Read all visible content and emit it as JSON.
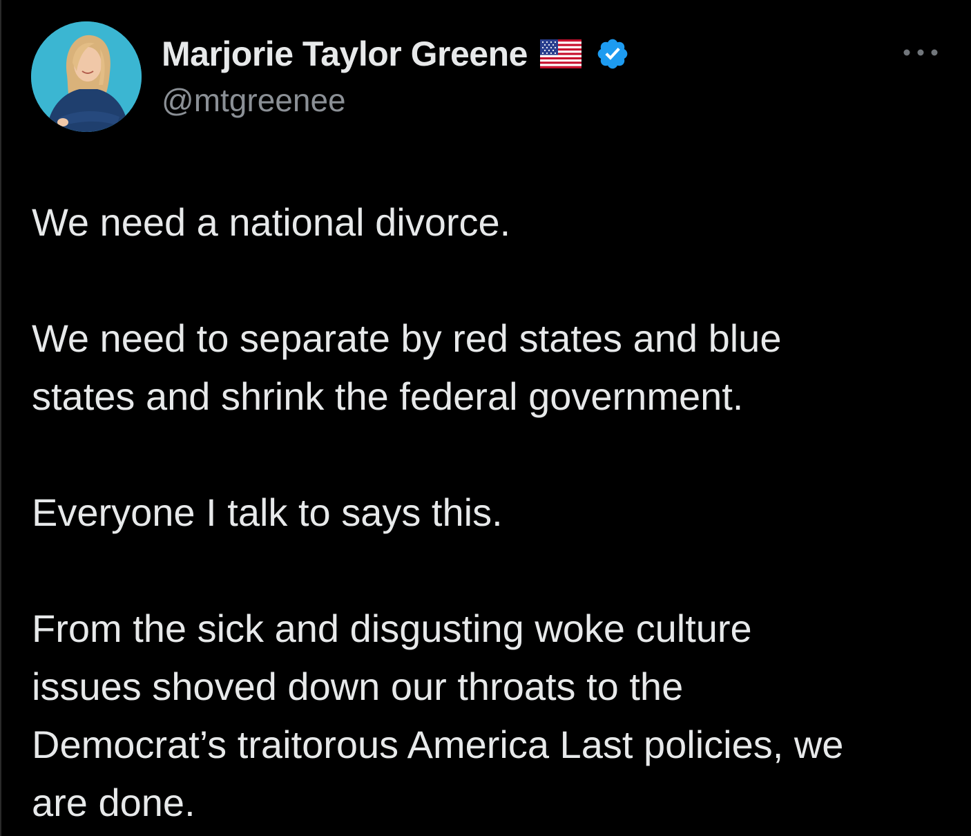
{
  "author": {
    "display_name": "Marjorie Taylor Greene",
    "handle": "@mtgreenee",
    "flag_icon": "us-flag-emoji",
    "verified_icon": "verified-badge-icon",
    "verified_color": "#1d9bf0",
    "avatar_bg": "#3bb6d2"
  },
  "menu": {
    "icon": "more-options-icon"
  },
  "tweet": {
    "paragraphs": [
      "We need a national divorce.",
      "We need to separate by red states and blue\nstates and shrink the federal government.",
      "Everyone I talk to says this.",
      "From the sick and disgusting woke culture\nissues shoved down our throats to the\nDemocrat’s traitorous America Last policies, we\nare done."
    ]
  },
  "colors": {
    "background": "#000000",
    "text": "#e7e9ea",
    "secondary_text": "#8b9096"
  }
}
